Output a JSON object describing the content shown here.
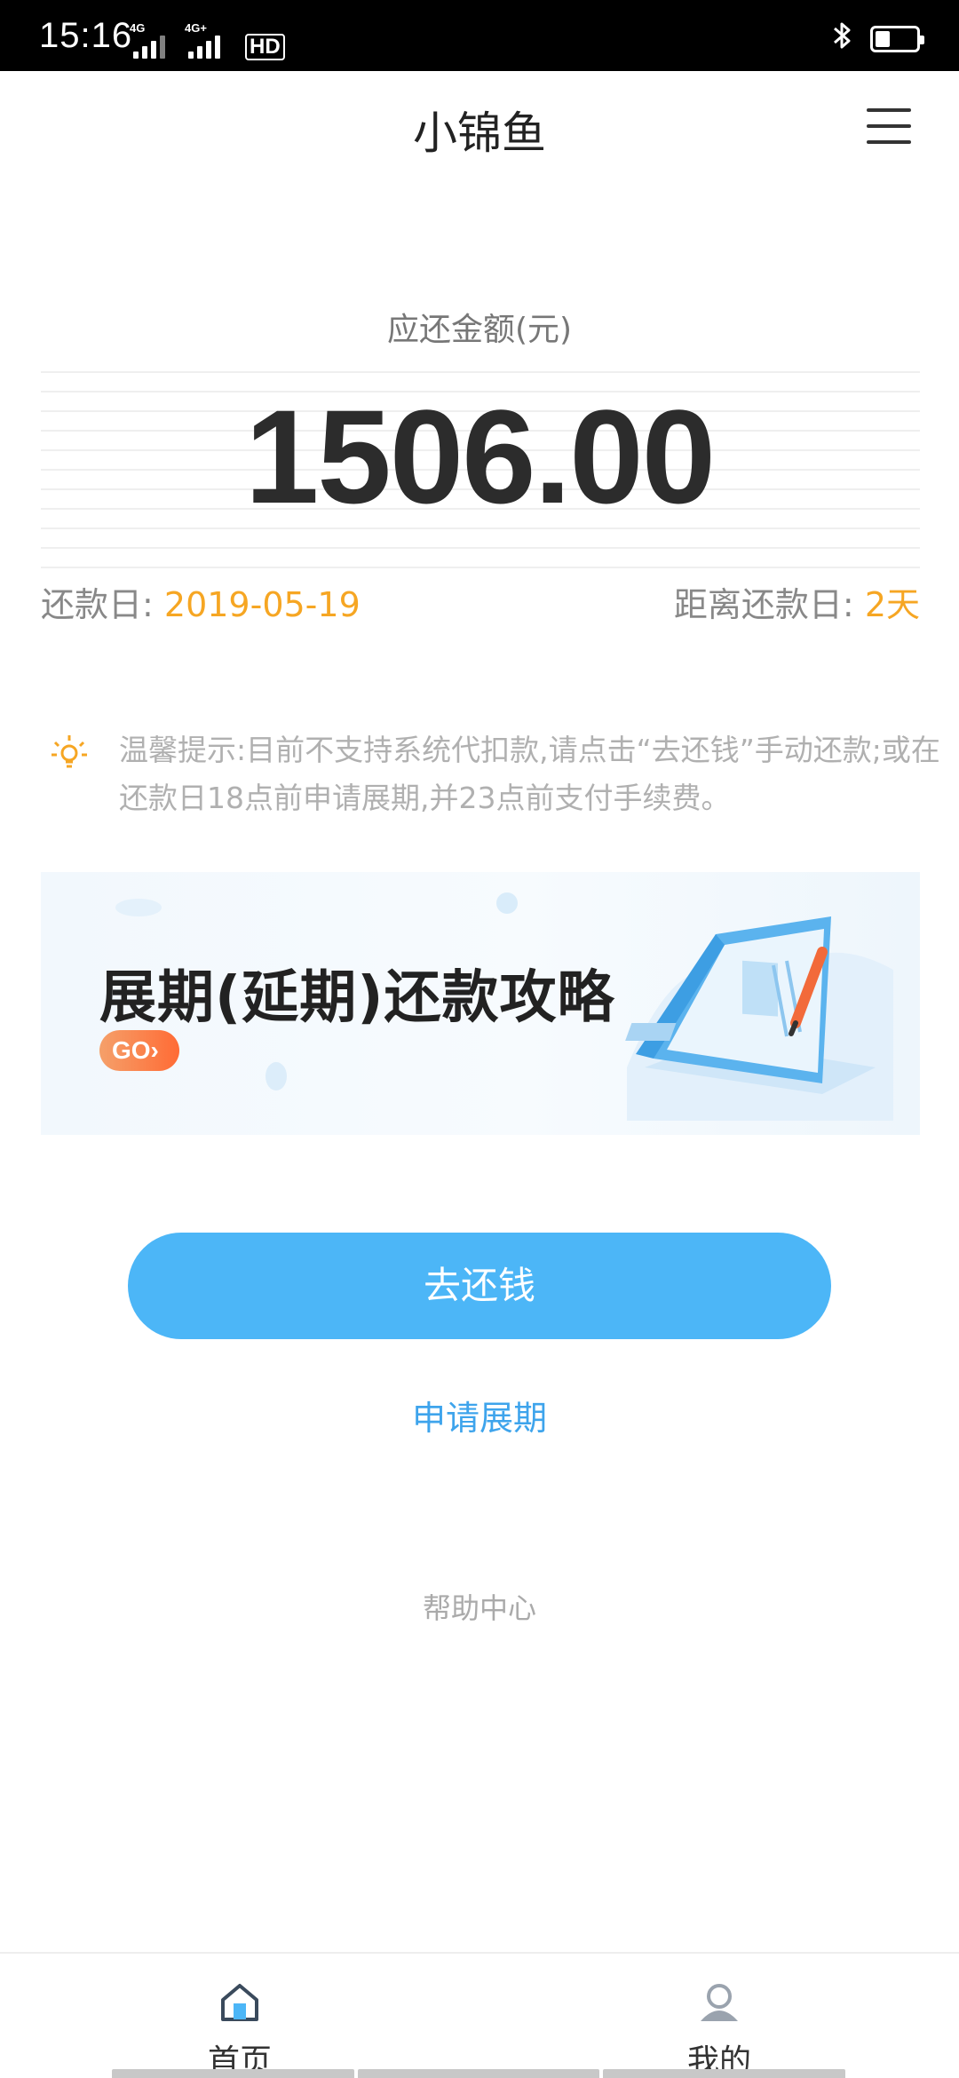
{
  "status_bar": {
    "time": "15:16",
    "signal_1_label": "4G",
    "signal_2_label": "4G+",
    "hd_label": "HD",
    "icons": [
      "signal-icon",
      "signal-icon",
      "hd-icon",
      "bluetooth-icon",
      "battery-icon"
    ]
  },
  "header": {
    "title": "小锦鱼",
    "menu_icon": "menu-icon"
  },
  "repayment": {
    "amount_label": "应还金额(元)",
    "amount": "1506.00",
    "due_date_label": "还款日:",
    "due_date": "2019-05-19",
    "days_left_label": "距离还款日:",
    "days_left": "2天"
  },
  "tip": {
    "icon": "lightbulb-icon",
    "text": "温馨提示:目前不支持系统代扣款,请点击“去还钱”手动还款;或在还款日18点前申请展期,并23点前支付手续费。"
  },
  "banner": {
    "title": "展期(延期)还款攻略",
    "go_label": "GO›"
  },
  "actions": {
    "pay_label": "去还钱",
    "extend_label": "申请展期",
    "help_label": "帮助中心"
  },
  "tabbar": {
    "items": [
      {
        "label": "首页",
        "icon": "home-icon"
      },
      {
        "label": "我的",
        "icon": "profile-icon"
      }
    ]
  },
  "colors": {
    "accent_blue": "#4cb6f7",
    "link_blue": "#3ea4ec",
    "highlight_orange": "#f6a623"
  }
}
